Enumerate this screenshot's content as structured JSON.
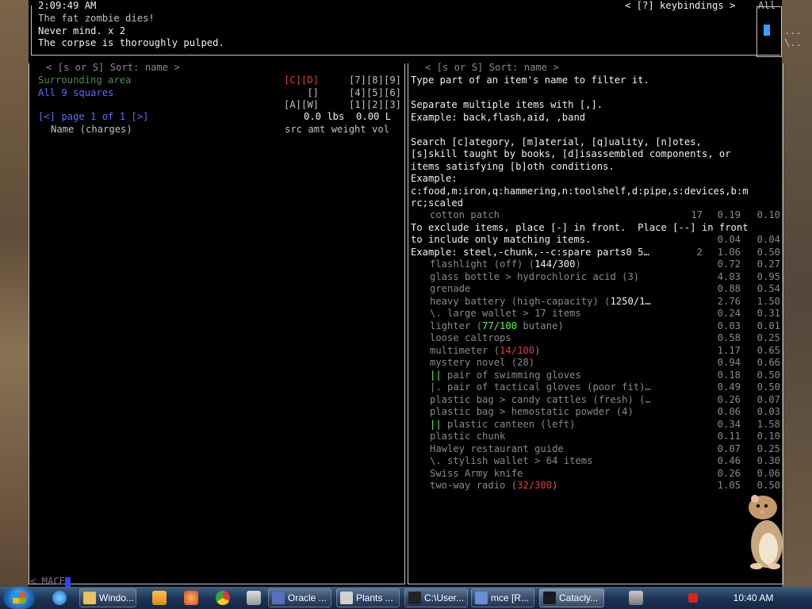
{
  "header": {
    "time": "2:09:49 AM",
    "keybindings": "< [?] keybindings >",
    "all_label": "All"
  },
  "log": [
    {
      "text": "The fat zombie dies!",
      "color": "gray"
    },
    {
      "text": "Never mind. x 2",
      "color": "white"
    },
    {
      "text": "The corpse is thoroughly pulped.",
      "color": "white"
    }
  ],
  "side_dots": [
    "...",
    "\\.."
  ],
  "left": {
    "sort_label": "< [s or S] Sort: name >",
    "source_rows": [
      {
        "label": "Surrounding area",
        "label_color": "dgreen",
        "codes": "[C][D]",
        "codes_color": "red",
        "keys": "[7][8][9]"
      },
      {
        "label": "All 9 squares",
        "label_color": "blue",
        "codes": "[]",
        "codes_color": "gray",
        "keys": "[4][5][6]"
      },
      {
        "label": "",
        "label_color": "gray",
        "codes": "[A][W]",
        "codes_color": "gray",
        "keys": "[1][2][3]"
      }
    ],
    "page_info": "[<] page 1 of 1 [>]",
    "weight_vol": "0.0 lbs  0.00 L",
    "column_name": "Name (charges)",
    "column_headers": "src amt weight vol",
    "filter_prompt": "< MACE"
  },
  "right": {
    "sort_label": "< [s or S] Sort: name >",
    "help_lines": [
      "Type part of an item's name to filter it.",
      "",
      "Separate multiple items with [,].",
      "Example: back,flash,aid, ,band",
      "",
      "Search [c]ategory, [m]aterial, [q]uality, [n]otes,",
      "[s]skill taught by books, [d]isassembled components, or",
      "items satisfying [b]oth conditions.",
      "Example:",
      "c:food,m:iron,q:hammering,n:toolshelf,d:pipe,s:devices,b:m",
      "rc;scaled"
    ],
    "items": [
      {
        "name": "cotton patch",
        "extra": "",
        "extra_color": "",
        "amt": "17",
        "weight": "0.19",
        "vol": "0.10"
      },
      {
        "name": "To exclude items, place [-] in front.  Place [--] in front",
        "special": true
      },
      {
        "name": "to include only matching items.",
        "special": true,
        "weight": "0.04",
        "vol": "0.04"
      },
      {
        "name": "Example: steel,-chunk,--c:spare parts0 5…",
        "special": true,
        "amt": "2",
        "weight": "1.06",
        "vol": "0.50"
      },
      {
        "name": "flashlight (off) (",
        "extra": "144/300",
        "extra_color": "white",
        "tail": ")",
        "amt": "",
        "weight": "0.72",
        "vol": "0.27"
      },
      {
        "name": "glass bottle > hydrochloric acid (3)",
        "extra": "",
        "amt": "",
        "weight": "4.03",
        "vol": "0.95"
      },
      {
        "name": "grenade",
        "extra": "",
        "amt": "",
        "weight": "0.88",
        "vol": "0.54"
      },
      {
        "name": "heavy battery (high-capacity) (",
        "extra": "1250/1…",
        "extra_color": "white",
        "tail": "",
        "amt": "",
        "weight": "2.76",
        "vol": "1.50"
      },
      {
        "name": "\\. large wallet > 17 items",
        "extra": "",
        "amt": "",
        "weight": "0.24",
        "vol": "0.31"
      },
      {
        "name": "lighter (",
        "extra": "77/100",
        "extra_color": "hl",
        "tail": " butane)",
        "amt": "",
        "weight": "0.03",
        "vol": "0.01"
      },
      {
        "name": "loose caltrops",
        "extra": "",
        "amt": "",
        "weight": "0.58",
        "vol": "0.25"
      },
      {
        "name": "multimeter (",
        "extra": "14/100",
        "extra_color": "red",
        "tail": ")",
        "amt": "",
        "weight": "1.17",
        "vol": "0.65"
      },
      {
        "name": "mystery novel (28)",
        "extra": "",
        "amt": "",
        "weight": "0.94",
        "vol": "0.66"
      },
      {
        "prefix": "||",
        "name": " pair of swimming gloves",
        "extra": "",
        "amt": "",
        "weight": "0.18",
        "vol": "0.50"
      },
      {
        "name": "|. pair of tactical gloves (poor fit)…",
        "extra": "",
        "amt": "",
        "weight": "0.49",
        "vol": "0.50"
      },
      {
        "name": "plastic bag > candy cattles (fresh) (…",
        "extra": "",
        "amt": "",
        "weight": "0.26",
        "vol": "0.07"
      },
      {
        "name": "plastic bag > hemostatic powder (4)",
        "extra": "",
        "amt": "",
        "weight": "0.06",
        "vol": "0.03"
      },
      {
        "prefix": "||",
        "name": " plastic canteen (left)",
        "extra": "",
        "amt": "",
        "weight": "0.34",
        "vol": "1.58"
      },
      {
        "name": "plastic chunk",
        "extra": "",
        "amt": "",
        "weight": "0.11",
        "vol": "0.10"
      },
      {
        "name": "Hawley restaurant guide",
        "extra": "",
        "amt": "",
        "weight": "0.07",
        "vol": "0.25"
      },
      {
        "name": "\\. stylish wallet > 64 items",
        "extra": "",
        "amt": "",
        "weight": "0.46",
        "vol": "0.30"
      },
      {
        "name": "Swiss Army knife",
        "extra": "",
        "amt": "",
        "weight": "0.26",
        "vol": "0.06"
      },
      {
        "name": "two-way radio (",
        "extra": "32/300",
        "extra_color": "red",
        "tail": ")",
        "amt": "",
        "weight": "1.05",
        "vol": "0.50"
      }
    ]
  },
  "taskbar": {
    "buttons": [
      {
        "label": "Windo...",
        "icon_color": "#e8c35a"
      },
      {
        "label": "Oracle ...",
        "icon_color": "#5a6fbf"
      },
      {
        "label": "Plants ...",
        "icon_color": "#d0d0d0"
      },
      {
        "label": "C:\\User...",
        "icon_color": "#222222"
      },
      {
        "label": "mce [R...",
        "icon_color": "#6a8fd0"
      },
      {
        "label": "Catacly...",
        "icon_color": "#1a1a1a"
      }
    ],
    "clock": "10:40 AM"
  }
}
